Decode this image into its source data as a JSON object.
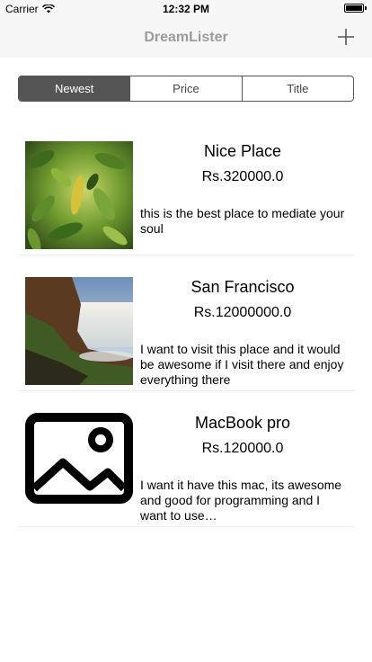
{
  "status_bar": {
    "carrier": "Carrier",
    "time": "12:32 PM",
    "battery_level": 1.0
  },
  "navbar": {
    "title": "DreamLister",
    "add_icon": "plus-icon"
  },
  "segments": [
    {
      "label": "Newest",
      "selected": true
    },
    {
      "label": "Price",
      "selected": false
    },
    {
      "label": "Title",
      "selected": false
    }
  ],
  "items": [
    {
      "title": "Nice Place",
      "price": "Rs.320000.0",
      "description": "this is the best place to mediate your soul",
      "image": "leaves-photo"
    },
    {
      "title": "San Francisco",
      "price": "Rs.12000000.0",
      "description": "I want to visit this place and it would be awesome if I visit there and enjoy everything there",
      "image": "waterfall-photo"
    },
    {
      "title": "MacBook pro",
      "price": "Rs.120000.0",
      "description": "I want it have this mac, its awesome and good for programming and I want to use…",
      "image": "image-placeholder-icon"
    }
  ],
  "colors": {
    "accent": "#555555",
    "title_gray": "#9b9b9b",
    "bar_bg": "#f7f7f7"
  }
}
